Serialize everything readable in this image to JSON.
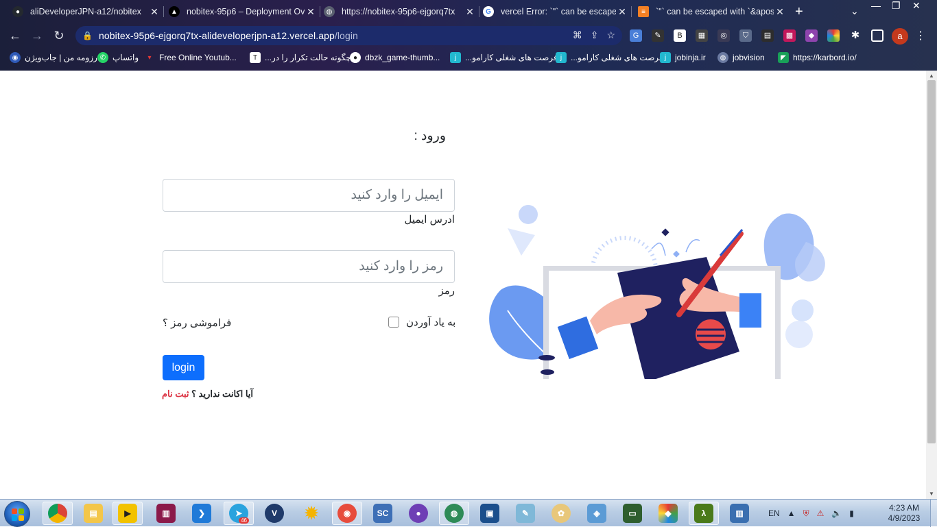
{
  "browser": {
    "tabs": [
      {
        "title": "aliDeveloperJPN-a12/nobitex",
        "icon": "github-icon"
      },
      {
        "title": "nobitex-95p6 – Deployment Ov",
        "icon": "vercel-icon"
      },
      {
        "title": "https://nobitex-95p6-ejgorq7tx",
        "icon": "globe-icon"
      },
      {
        "title": "vercel Error: `\"` can be escaped",
        "icon": "google-icon"
      },
      {
        "title": "`\"` can be escaped with `&apos;",
        "icon": "stackoverflow-icon"
      }
    ],
    "active_tab": 2,
    "url_host": "nobitex-95p6-ejgorq7tx-alideveloperjpn-a12.vercel.app",
    "url_path": "/login",
    "profile_initial": "a",
    "bookmarks": [
      {
        "label": "رزومه من | جاب‌ویژن",
        "icon": "jobvision-icon"
      },
      {
        "label": "واتساپ",
        "icon": "whatsapp-icon"
      },
      {
        "label": "Free Online Youtub...",
        "icon": "youtube-icon"
      },
      {
        "label": "چگونه حالت تکرار را در...",
        "icon": "t-icon"
      },
      {
        "label": "dbzk_game-thumb...",
        "icon": "github-icon"
      },
      {
        "label": "فرصت های شغلی کارامو...",
        "icon": "jobinja-icon"
      },
      {
        "label": "فرصت های شغلی کارامو...",
        "icon": "jobinja-icon"
      },
      {
        "label": "jobinja.ir",
        "icon": "jobinja-icon"
      },
      {
        "label": "jobvision",
        "icon": "globe-icon"
      },
      {
        "label": "https://karbord.io/",
        "icon": "karbord-icon"
      }
    ]
  },
  "login": {
    "title": "ورود :",
    "email_placeholder": "ایمیل را وارد کنید",
    "email_label": "ادرس ایمیل",
    "password_placeholder": "رمز را وارد کنید",
    "password_label": "رمز",
    "remember_label": "به یاد آوردن",
    "forgot_label": "فراموشی رمز ؟",
    "login_button": "login",
    "no_account_text": "آیا اکانت ندارید ؟ ",
    "signup_link": "ثبت نام"
  },
  "taskbar": {
    "apps": [
      "chrome-icon",
      "file-explorer-icon",
      "kmplayer-icon",
      "winrar-icon",
      "vscode-icon",
      "telegram-icon",
      "v2ray-icon",
      "weather-icon",
      "recorder-icon",
      "screencast-icon",
      "github-desktop-icon",
      "network-icon",
      "virtualbox-icon",
      "notes-icon",
      "paint-icon",
      "cube-icon",
      "terminal-icon",
      "git-icon",
      "lambda-icon",
      "remote-desktop-icon"
    ],
    "telegram_badge": "46",
    "language": "EN",
    "time": "4:23 AM",
    "date": "4/9/2023"
  },
  "colors": {
    "primary": "#0d6efd",
    "danger": "#dc3545",
    "illustration_navy": "#1f2160",
    "illustration_blue": "#3b82f6"
  }
}
